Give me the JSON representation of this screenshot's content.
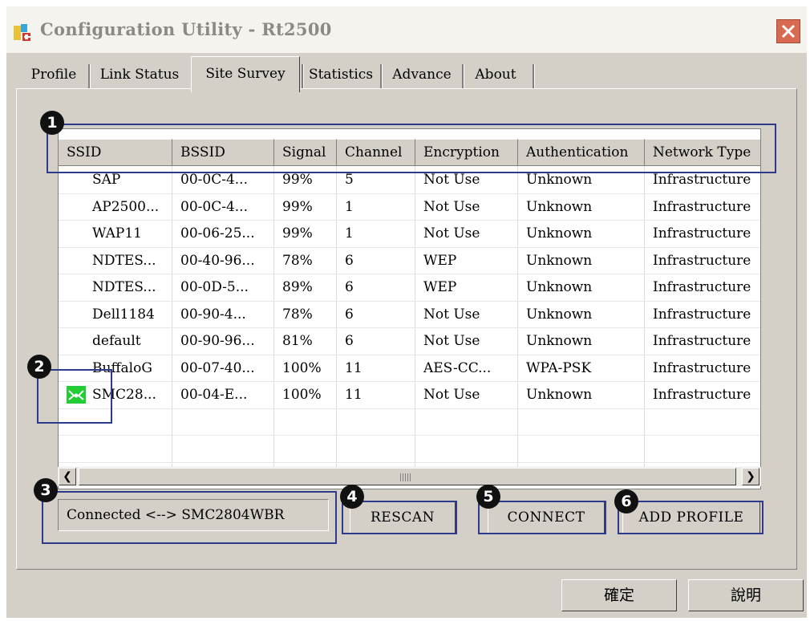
{
  "window": {
    "title": "Configuration Utility - Rt2500",
    "icon": "rt-app-icon"
  },
  "tabs": [
    {
      "label": "Profile"
    },
    {
      "label": "Link Status"
    },
    {
      "label": "Site Survey",
      "active": true
    },
    {
      "label": "Statistics"
    },
    {
      "label": "Advance"
    },
    {
      "label": "About"
    }
  ],
  "table": {
    "columns": [
      "SSID",
      "BSSID",
      "Signal",
      "Channel",
      "Encryption",
      "Authentication",
      "Network Type"
    ],
    "rows": [
      [
        "SAP",
        "00-0C-4...",
        "99%",
        "5",
        "Not Use",
        "Unknown",
        "Infrastructure"
      ],
      [
        "AP2500...",
        "00-0C-4...",
        "99%",
        "1",
        "Not Use",
        "Unknown",
        "Infrastructure"
      ],
      [
        "WAP11",
        "00-06-25...",
        "99%",
        "1",
        "Not Use",
        "Unknown",
        "Infrastructure"
      ],
      [
        "NDTES...",
        "00-40-96...",
        "78%",
        "6",
        "WEP",
        "Unknown",
        "Infrastructure"
      ],
      [
        "NDTES...",
        "00-0D-5...",
        "89%",
        "6",
        "WEP",
        "Unknown",
        "Infrastructure"
      ],
      [
        "Dell1184",
        "00-90-4...",
        "78%",
        "6",
        "Not Use",
        "Unknown",
        "Infrastructure"
      ],
      [
        "default",
        "00-90-96...",
        "81%",
        "6",
        "Not Use",
        "Unknown",
        "Infrastructure"
      ],
      [
        "BuffaloG",
        "00-07-40...",
        "100%",
        "11",
        "AES-CC...",
        "WPA-PSK",
        "Infrastructure"
      ],
      [
        "SMC28...",
        "00-04-E...",
        "100%",
        "11",
        "Not Use",
        "Unknown",
        "Infrastructure"
      ]
    ],
    "connected_row_icon": "connected-network-icon"
  },
  "status": {
    "text": "Connected <--> SMC2804WBR"
  },
  "buttons": {
    "rescan": "RESCAN",
    "connect": "CONNECT",
    "add_profile": "ADD PROFILE"
  },
  "annotations": [
    "1",
    "2",
    "3",
    "4",
    "5",
    "6"
  ],
  "footer": {
    "ok": "確定",
    "help": "說明"
  },
  "colors": {
    "annotation_box": "#2e3a8c",
    "connected_icon": "#22cc33",
    "close_button": "#d96a52"
  }
}
